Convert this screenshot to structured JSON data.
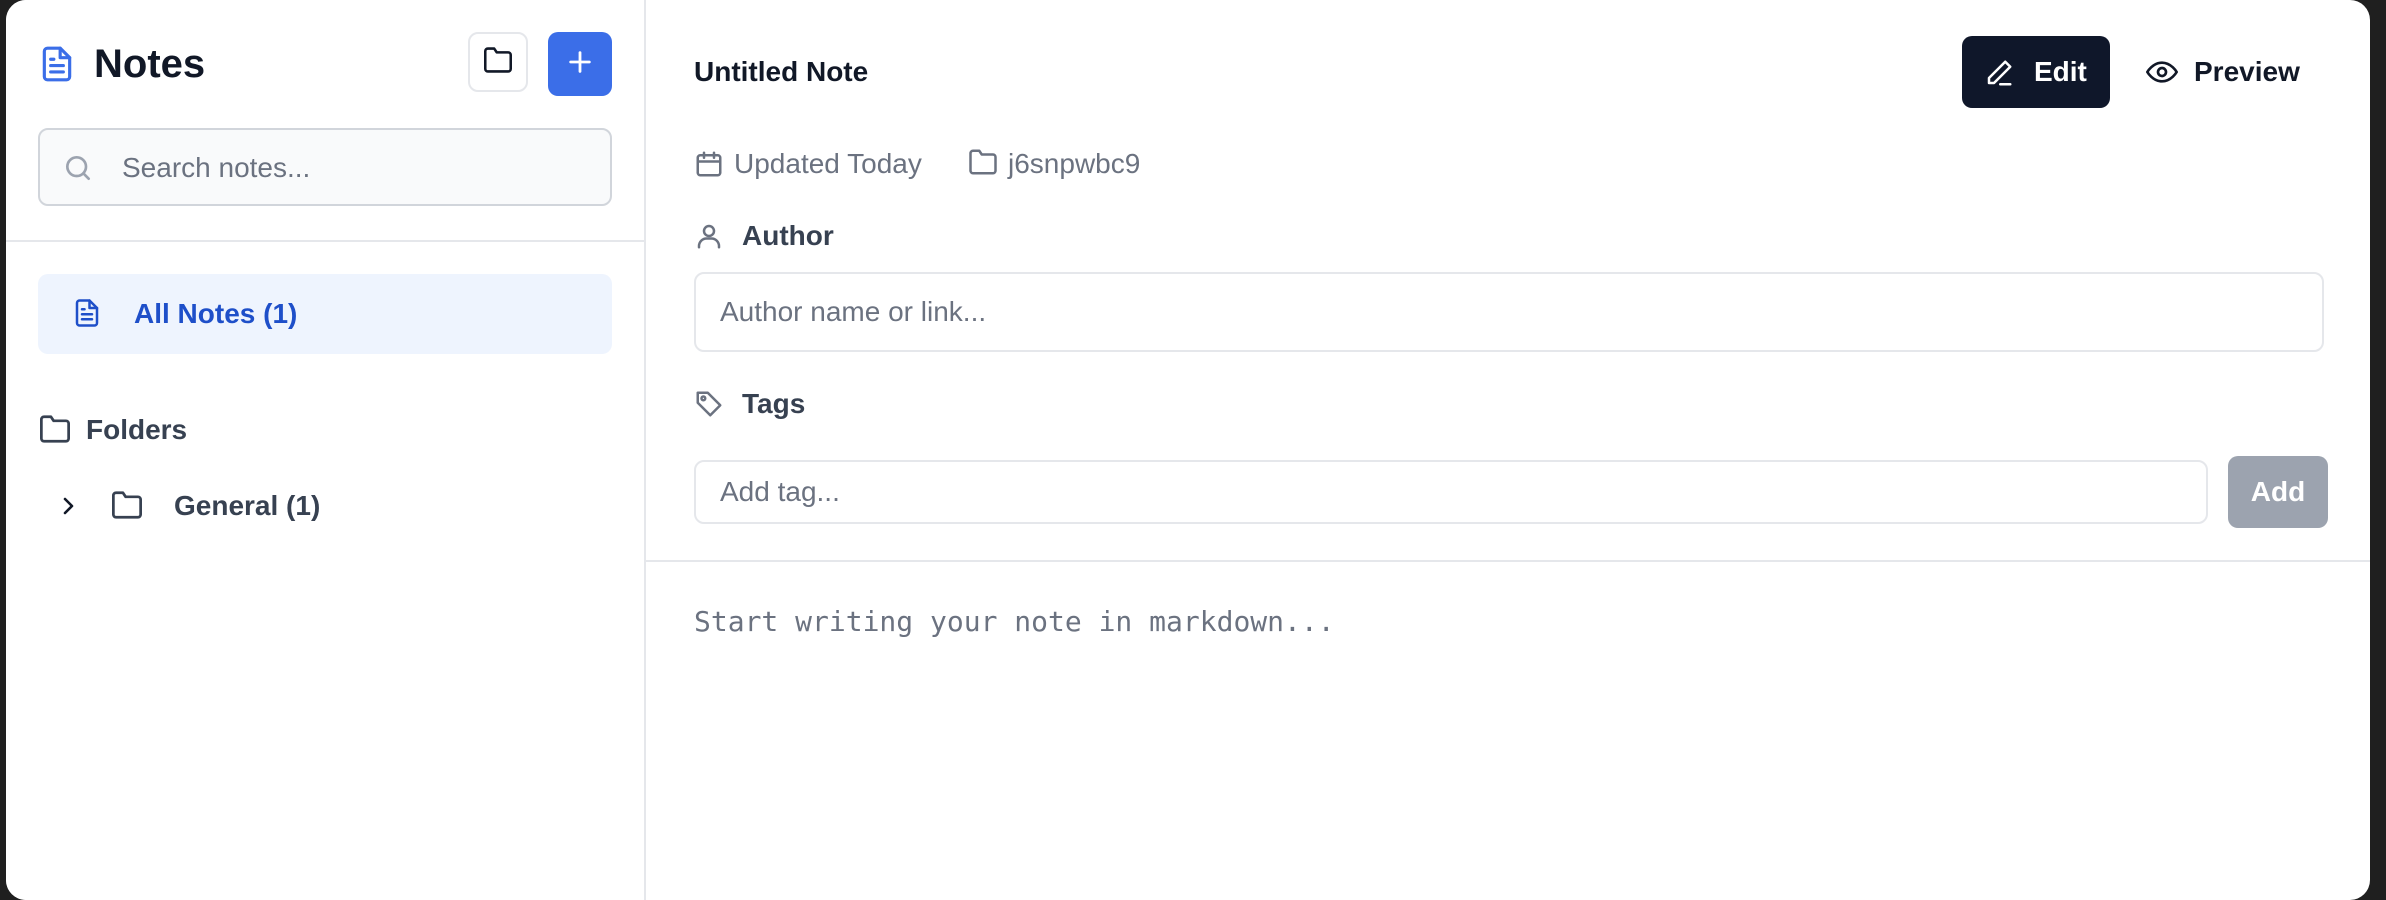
{
  "sidebar": {
    "app_title": "Notes",
    "new_folder_icon": "folder-plus-icon",
    "new_note_icon": "plus-icon",
    "search_placeholder": "Search notes...",
    "all_notes_label": "All Notes (1)",
    "folders_heading": "Folders",
    "folders": [
      {
        "label": "General (1)",
        "expanded": false
      }
    ]
  },
  "note": {
    "title": "Untitled Note",
    "edit_label": "Edit",
    "preview_label": "Preview",
    "mode": "edit",
    "updated": "Updated Today",
    "folder_id": "j6snpwbc9",
    "author_label": "Author",
    "author_placeholder": "Author name or link...",
    "tags_label": "Tags",
    "tag_placeholder": "Add tag...",
    "add_tag_label": "Add",
    "body_placeholder": "Start writing your note in markdown..."
  },
  "colors": {
    "accent": "#3b6ee8",
    "active_nav_bg": "#eef4fe",
    "active_nav_text": "#1e4fc9",
    "edit_button_bg": "#0f172a",
    "add_tag_disabled_bg": "#9ca3af"
  }
}
